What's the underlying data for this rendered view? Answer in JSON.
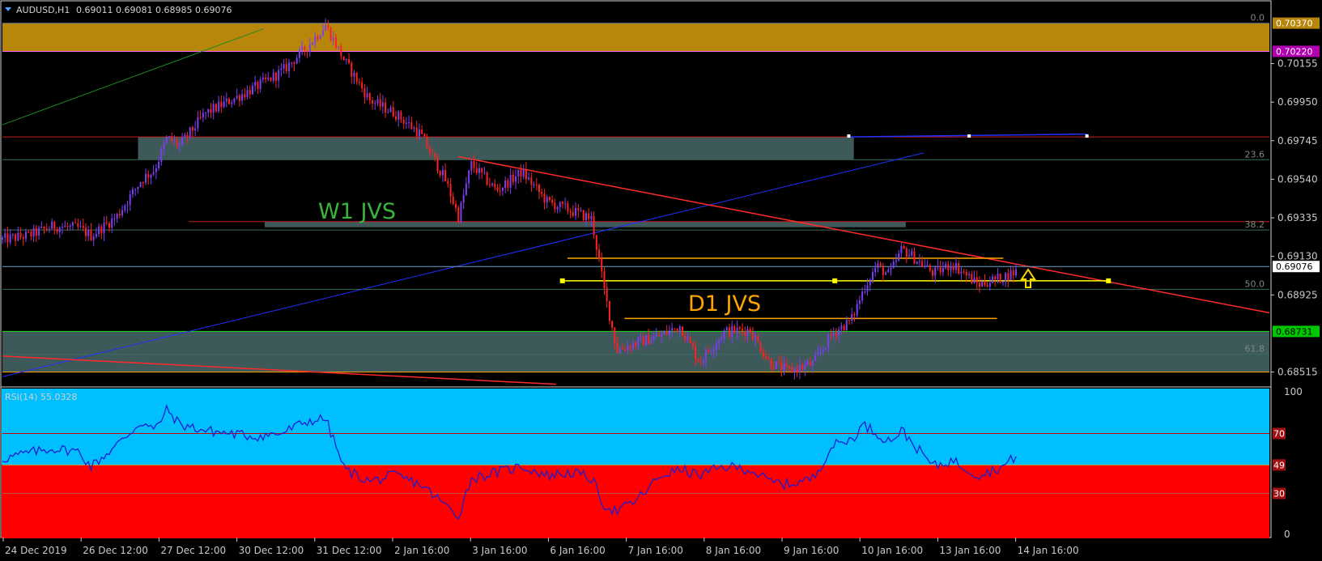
{
  "header": {
    "symbol": "AUDUSD,H1",
    "ohlc": "0.69011 0.69081 0.68985 0.69076",
    "rsi_label": "RSI(14) 55.0328"
  },
  "colors": {
    "bull": "#7b3ff2",
    "bear": "#ff2020",
    "resistance_zone": "#b8860b",
    "grey_zone": "#3e5959",
    "trendline": "#ff2a2a",
    "blue_line": "#2030ff",
    "orange_line": "#ffa500",
    "yellow_line": "#ffff00",
    "rsi_upper": "#00bfff",
    "rsi_lower": "#ff0000",
    "rsi_line": "#1e1ecc"
  },
  "annotations": {
    "w1": "W1 JVS",
    "d1": "D1 JVS",
    "w1_color": "#3cb43c",
    "d1_color": "#ffa500"
  },
  "chart_data": [
    {
      "type": "candlestick",
      "symbol": "AUDUSD",
      "timeframe": "H1",
      "ylim": [
        0.6844,
        0.7045
      ],
      "x_tick_labels": [
        "24 Dec 2019",
        "26 Dec 12:00",
        "27 Dec 12:00",
        "30 Dec 12:00",
        "31 Dec 12:00",
        "2 Jan 16:00",
        "3 Jan 16:00",
        "6 Jan 16:00",
        "7 Jan 16:00",
        "8 Jan 16:00",
        "9 Jan 16:00",
        "10 Jan 16:00",
        "13 Jan 16:00",
        "14 Jan 16:00"
      ],
      "y_ticks": [
        0.70155,
        0.6995,
        0.69745,
        0.6954,
        0.69335,
        0.6913,
        0.68925,
        0.68515
      ],
      "price_tags": [
        {
          "value": 0.7037,
          "label": "0.70370",
          "color": "#b8860b"
        },
        {
          "value": 0.7022,
          "label": "0.70220",
          "color": "#b000b0"
        },
        {
          "value": 0.69076,
          "label": "0.69076",
          "color": "#ffffff"
        },
        {
          "value": 0.68731,
          "label": "0.68731",
          "color": "#00c800"
        }
      ],
      "fib_levels": [
        {
          "label": "0.0",
          "value": 0.7037
        },
        {
          "label": "23.6",
          "value": 0.69644
        },
        {
          "label": "38.2",
          "value": 0.6927
        },
        {
          "label": "50.0",
          "value": 0.68955
        },
        {
          "label": "61.8",
          "value": 0.6861
        }
      ],
      "zones": [
        {
          "name": "resistance",
          "from": 0.7022,
          "to": 0.7037
        },
        {
          "name": "upper-grey",
          "from": 0.69645,
          "to": 0.69765
        },
        {
          "name": "w1-grey",
          "from": 0.69285,
          "to": 0.69315
        },
        {
          "name": "lower-grey",
          "from": 0.68515,
          "to": 0.68731
        }
      ],
      "path": [
        {
          "t": 0,
          "p": 0.6922
        },
        {
          "t": 0.02,
          "p": 0.6924
        },
        {
          "t": 0.04,
          "p": 0.6929
        },
        {
          "t": 0.06,
          "p": 0.6928
        },
        {
          "t": 0.07,
          "p": 0.6924
        },
        {
          "t": 0.09,
          "p": 0.6934
        },
        {
          "t": 0.11,
          "p": 0.6954
        },
        {
          "t": 0.12,
          "p": 0.6959
        },
        {
          "t": 0.13,
          "p": 0.6976
        },
        {
          "t": 0.14,
          "p": 0.6972
        },
        {
          "t": 0.16,
          "p": 0.6989
        },
        {
          "t": 0.18,
          "p": 0.6996
        },
        {
          "t": 0.2,
          "p": 0.7003
        },
        {
          "t": 0.22,
          "p": 0.7011
        },
        {
          "t": 0.24,
          "p": 0.7024
        },
        {
          "t": 0.255,
          "p": 0.7036
        },
        {
          "t": 0.27,
          "p": 0.7017
        },
        {
          "t": 0.29,
          "p": 0.6996
        },
        {
          "t": 0.31,
          "p": 0.6989
        },
        {
          "t": 0.33,
          "p": 0.6978
        },
        {
          "t": 0.35,
          "p": 0.6953
        },
        {
          "t": 0.36,
          "p": 0.6934
        },
        {
          "t": 0.37,
          "p": 0.6962
        },
        {
          "t": 0.39,
          "p": 0.6948
        },
        {
          "t": 0.41,
          "p": 0.6958
        },
        {
          "t": 0.43,
          "p": 0.6942
        },
        {
          "t": 0.45,
          "p": 0.6937
        },
        {
          "t": 0.465,
          "p": 0.6933
        },
        {
          "t": 0.475,
          "p": 0.6895
        },
        {
          "t": 0.485,
          "p": 0.6863
        },
        {
          "t": 0.5,
          "p": 0.6867
        },
        {
          "t": 0.52,
          "p": 0.6871
        },
        {
          "t": 0.535,
          "p": 0.6876
        },
        {
          "t": 0.55,
          "p": 0.6857
        },
        {
          "t": 0.57,
          "p": 0.6873
        },
        {
          "t": 0.59,
          "p": 0.6874
        },
        {
          "t": 0.605,
          "p": 0.6857
        },
        {
          "t": 0.62,
          "p": 0.6852
        },
        {
          "t": 0.64,
          "p": 0.6856
        },
        {
          "t": 0.655,
          "p": 0.6872
        },
        {
          "t": 0.67,
          "p": 0.6879
        },
        {
          "t": 0.68,
          "p": 0.6896
        },
        {
          "t": 0.69,
          "p": 0.6908
        },
        {
          "t": 0.7,
          "p": 0.6903
        },
        {
          "t": 0.71,
          "p": 0.6917
        },
        {
          "t": 0.72,
          "p": 0.6912
        },
        {
          "t": 0.735,
          "p": 0.6904
        },
        {
          "t": 0.75,
          "p": 0.6909
        },
        {
          "t": 0.77,
          "p": 0.6898
        },
        {
          "t": 0.79,
          "p": 0.6902
        },
        {
          "t": 0.8,
          "p": 0.6905
        }
      ]
    },
    {
      "type": "line",
      "name": "RSI(14)",
      "ylim": [
        0,
        100
      ],
      "y_ticks": [
        100,
        70,
        49,
        30,
        0
      ],
      "levels": [
        70,
        49,
        30
      ],
      "last_value": 55.0328,
      "path": [
        {
          "t": 0,
          "p": 53
        },
        {
          "t": 0.02,
          "p": 57
        },
        {
          "t": 0.04,
          "p": 60
        },
        {
          "t": 0.06,
          "p": 58
        },
        {
          "t": 0.07,
          "p": 48
        },
        {
          "t": 0.09,
          "p": 62
        },
        {
          "t": 0.11,
          "p": 78
        },
        {
          "t": 0.12,
          "p": 72
        },
        {
          "t": 0.13,
          "p": 86
        },
        {
          "t": 0.14,
          "p": 76
        },
        {
          "t": 0.16,
          "p": 72
        },
        {
          "t": 0.18,
          "p": 70
        },
        {
          "t": 0.2,
          "p": 68
        },
        {
          "t": 0.22,
          "p": 70
        },
        {
          "t": 0.24,
          "p": 78
        },
        {
          "t": 0.255,
          "p": 80
        },
        {
          "t": 0.27,
          "p": 46
        },
        {
          "t": 0.29,
          "p": 38
        },
        {
          "t": 0.31,
          "p": 42
        },
        {
          "t": 0.33,
          "p": 36
        },
        {
          "t": 0.35,
          "p": 22
        },
        {
          "t": 0.36,
          "p": 15
        },
        {
          "t": 0.37,
          "p": 40
        },
        {
          "t": 0.39,
          "p": 44
        },
        {
          "t": 0.41,
          "p": 48
        },
        {
          "t": 0.43,
          "p": 42
        },
        {
          "t": 0.45,
          "p": 44
        },
        {
          "t": 0.465,
          "p": 40
        },
        {
          "t": 0.475,
          "p": 22
        },
        {
          "t": 0.485,
          "p": 18
        },
        {
          "t": 0.5,
          "p": 25
        },
        {
          "t": 0.52,
          "p": 42
        },
        {
          "t": 0.535,
          "p": 46
        },
        {
          "t": 0.55,
          "p": 42
        },
        {
          "t": 0.57,
          "p": 48
        },
        {
          "t": 0.59,
          "p": 46
        },
        {
          "t": 0.605,
          "p": 38
        },
        {
          "t": 0.62,
          "p": 36
        },
        {
          "t": 0.64,
          "p": 40
        },
        {
          "t": 0.655,
          "p": 62
        },
        {
          "t": 0.67,
          "p": 66
        },
        {
          "t": 0.68,
          "p": 76
        },
        {
          "t": 0.69,
          "p": 70
        },
        {
          "t": 0.7,
          "p": 65
        },
        {
          "t": 0.71,
          "p": 72
        },
        {
          "t": 0.72,
          "p": 62
        },
        {
          "t": 0.735,
          "p": 48
        },
        {
          "t": 0.75,
          "p": 52
        },
        {
          "t": 0.77,
          "p": 42
        },
        {
          "t": 0.79,
          "p": 48
        },
        {
          "t": 0.8,
          "p": 55
        }
      ]
    }
  ]
}
